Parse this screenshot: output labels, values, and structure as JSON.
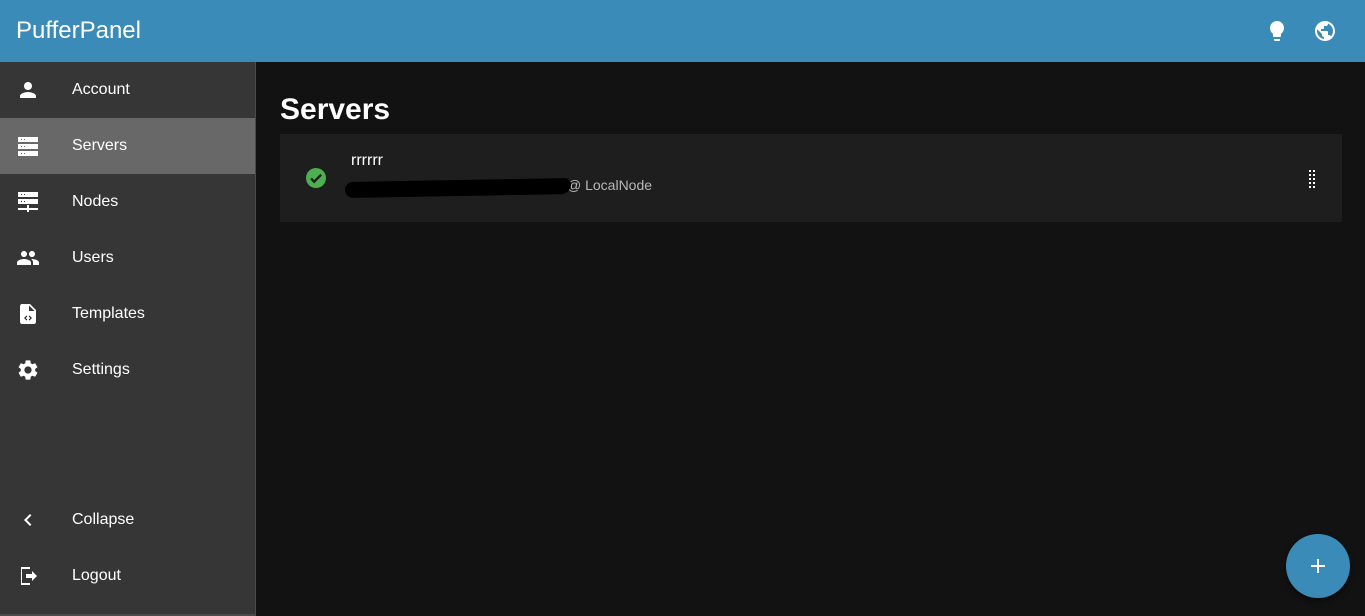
{
  "app": {
    "title": "PufferPanel",
    "actions": [
      {
        "icon": "lightbulb-icon",
        "label": "Toggle theme"
      },
      {
        "icon": "globe-icon",
        "label": "Language"
      }
    ],
    "colors": {
      "primary": "#3a8bb7",
      "success": "#4caf50"
    }
  },
  "sidebar": {
    "items": [
      {
        "label": "Account",
        "icon": "account-icon",
        "active": false
      },
      {
        "label": "Servers",
        "icon": "servers-icon",
        "active": true
      },
      {
        "label": "Nodes",
        "icon": "nodes-icon",
        "active": false
      },
      {
        "label": "Users",
        "icon": "users-icon",
        "active": false
      },
      {
        "label": "Templates",
        "icon": "templates-icon",
        "active": false
      },
      {
        "label": "Settings",
        "icon": "settings-icon",
        "active": false
      }
    ],
    "bottom": [
      {
        "label": "Collapse",
        "icon": "chevron-left-icon"
      },
      {
        "label": "Logout",
        "icon": "logout-icon"
      }
    ]
  },
  "main": {
    "title": "Servers",
    "servers": [
      {
        "name": "rrrrrr",
        "address_redacted": true,
        "node": "@ LocalNode",
        "status": "online"
      }
    ],
    "add_button_icon": "plus-icon"
  }
}
